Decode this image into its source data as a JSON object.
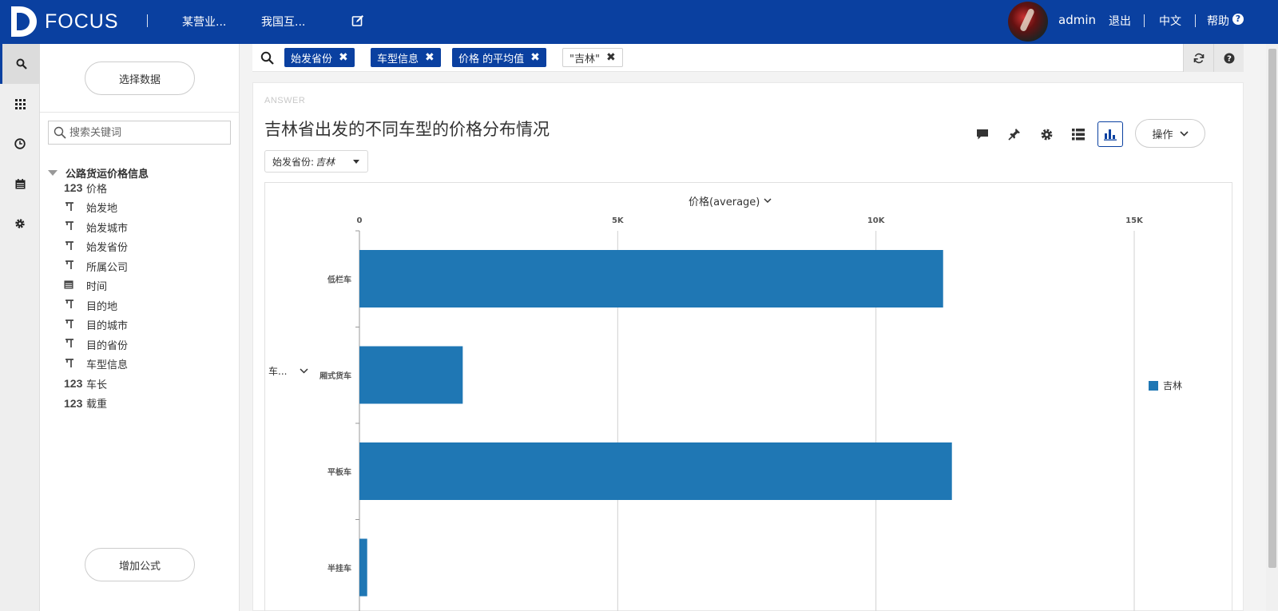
{
  "brand": {
    "name": "FOCUS",
    "color": "#0a40a0"
  },
  "topnav": {
    "tabs": [
      "某营业...",
      "我国互..."
    ],
    "user": "admin",
    "logout": "退出",
    "language": "中文",
    "help": "帮助"
  },
  "sidebar_icons": [
    "search-icon",
    "apps-grid-icon",
    "clock-icon",
    "calendar-icon",
    "gear-icon"
  ],
  "data_panel": {
    "select_data_button": "选择数据",
    "search_placeholder": "搜索关键词",
    "table_name": "公路货运价格信息",
    "fields": [
      {
        "type": "123",
        "name": "价格"
      },
      {
        "type": "T",
        "name": "始发地"
      },
      {
        "type": "T",
        "name": "始发城市"
      },
      {
        "type": "T",
        "name": "始发省份"
      },
      {
        "type": "T",
        "name": "所属公司"
      },
      {
        "type": "cal",
        "name": "时间"
      },
      {
        "type": "T",
        "name": "目的地"
      },
      {
        "type": "T",
        "name": "目的城市"
      },
      {
        "type": "T",
        "name": "目的省份"
      },
      {
        "type": "T",
        "name": "车型信息"
      },
      {
        "type": "123",
        "name": "车长"
      },
      {
        "type": "123",
        "name": "载重"
      }
    ],
    "add_formula_button": "增加公式"
  },
  "query": {
    "chips": [
      "始发省份",
      "车型信息",
      "价格 的平均值"
    ],
    "value_chip": "\"吉林\""
  },
  "answer": {
    "label": "ANSWER",
    "title": "吉林省出发的不同车型的价格分布情况",
    "filter_label": "始发省份:",
    "filter_value": "吉林",
    "ops_button": "操作",
    "measure_selector": "价格(average)",
    "dimension_selector": "车..."
  },
  "chart_data": {
    "type": "bar",
    "orientation": "horizontal",
    "categories": [
      "低栏车",
      "厢式货车",
      "平板车",
      "半挂车"
    ],
    "series": [
      {
        "name": "吉林",
        "values": [
          11300,
          2000,
          11470,
          150
        ],
        "color": "#1f77b4"
      }
    ],
    "x_ticks": [
      {
        "value": 0,
        "label": "0"
      },
      {
        "value": 5000,
        "label": "5K"
      },
      {
        "value": 10000,
        "label": "10K"
      },
      {
        "value": 15000,
        "label": "15K"
      }
    ],
    "xlim": [
      0,
      15000
    ],
    "grid": true,
    "legend_position": "right"
  }
}
